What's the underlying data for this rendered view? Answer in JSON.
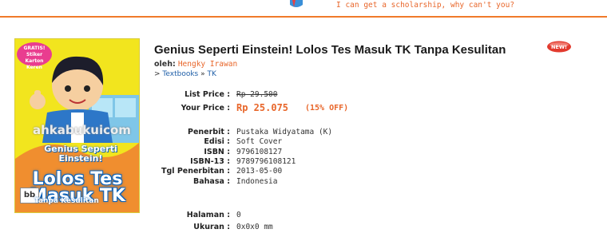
{
  "header": {
    "scholarship_text": "I can get a scholarship, why can't you?"
  },
  "book": {
    "title": "Genius Seperti Einstein! Lolos Tes Masuk TK Tanpa Kesulitan",
    "new_badge": "NEW!",
    "author_label": "oleh:",
    "author": "Hengky Irawan",
    "breadcrumb": {
      "prefix": "> ",
      "category": "Textbooks",
      "separator": " » ",
      "subcategory": "TK"
    },
    "cover": {
      "badge": "GRATIS! Stiker Karton Keren",
      "watermark": "ahkabukuicom",
      "subtitle": "Genius Seperti Einstein!",
      "title": "Lolos Tes Masuk TK",
      "publisher_mark": "bb",
      "bottom": "Tanpa Kesulitan"
    },
    "list_price_label": "List Price :",
    "list_price": "Rp 29.500",
    "your_price_label": "Your Price :",
    "your_price": "Rp 25.075",
    "discount": "(15% OFF)",
    "details": [
      {
        "label": "Penerbit :",
        "value": "Pustaka Widyatama (K)"
      },
      {
        "label": "Edisi :",
        "value": "Soft Cover"
      },
      {
        "label": "ISBN :",
        "value": "9796108127"
      },
      {
        "label": "ISBN-13 :",
        "value": "9789796108121"
      },
      {
        "label": "Tgl Penerbitan :",
        "value": "2013-05-00"
      },
      {
        "label": "Bahasa :",
        "value": "Indonesia"
      }
    ],
    "extra": [
      {
        "label": "Halaman :",
        "value": "0"
      },
      {
        "label": "Ukuran :",
        "value": "0x0x0 mm"
      }
    ]
  },
  "colors": {
    "accent": "#e8662a",
    "link": "#1f5fa8",
    "cover_yellow": "#f2e51e",
    "cover_blue": "#0b61b8"
  }
}
